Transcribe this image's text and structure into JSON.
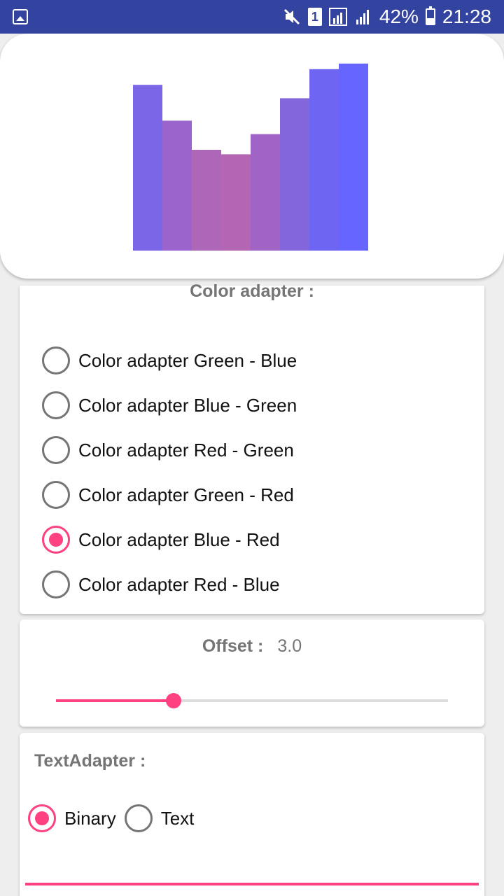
{
  "status_bar": {
    "battery_percent": "42%",
    "time": "21:28",
    "sim_label": "1",
    "icons": [
      "image-notification-icon",
      "mute-icon",
      "sim-icon",
      "signal-icon",
      "signal-icon",
      "battery-icon"
    ]
  },
  "chart_data": {
    "type": "bar",
    "values": [
      0.74,
      0.58,
      0.45,
      0.43,
      0.52,
      0.68,
      0.81,
      0.835
    ],
    "colors": [
      "#7a66e6",
      "#9a64cc",
      "#ad66b8",
      "#b466b4",
      "#9f64c6",
      "#8466dc",
      "#6e66f2",
      "#6666ff"
    ],
    "ylim": [
      0,
      1
    ]
  },
  "color_adapter": {
    "title": "Color adapter :",
    "options": [
      {
        "label": "Color adapter Green - Blue",
        "checked": false
      },
      {
        "label": "Color adapter Blue - Green",
        "checked": false
      },
      {
        "label": "Color adapter Red - Green",
        "checked": false
      },
      {
        "label": "Color adapter Green - Red",
        "checked": false
      },
      {
        "label": "Color adapter Blue - Red",
        "checked": true
      },
      {
        "label": "Color adapter Red - Blue",
        "checked": false
      }
    ]
  },
  "offset": {
    "label": "Offset :",
    "value": "3.0",
    "slider_fraction": 0.3
  },
  "text_adapter": {
    "title": "TextAdapter :",
    "options": [
      {
        "label": "Binary",
        "checked": true
      },
      {
        "label": "Text",
        "checked": false
      }
    ]
  },
  "colors": {
    "accent": "#ff4081",
    "status_bar": "#3344a0",
    "radio_unchecked": "#757575"
  }
}
